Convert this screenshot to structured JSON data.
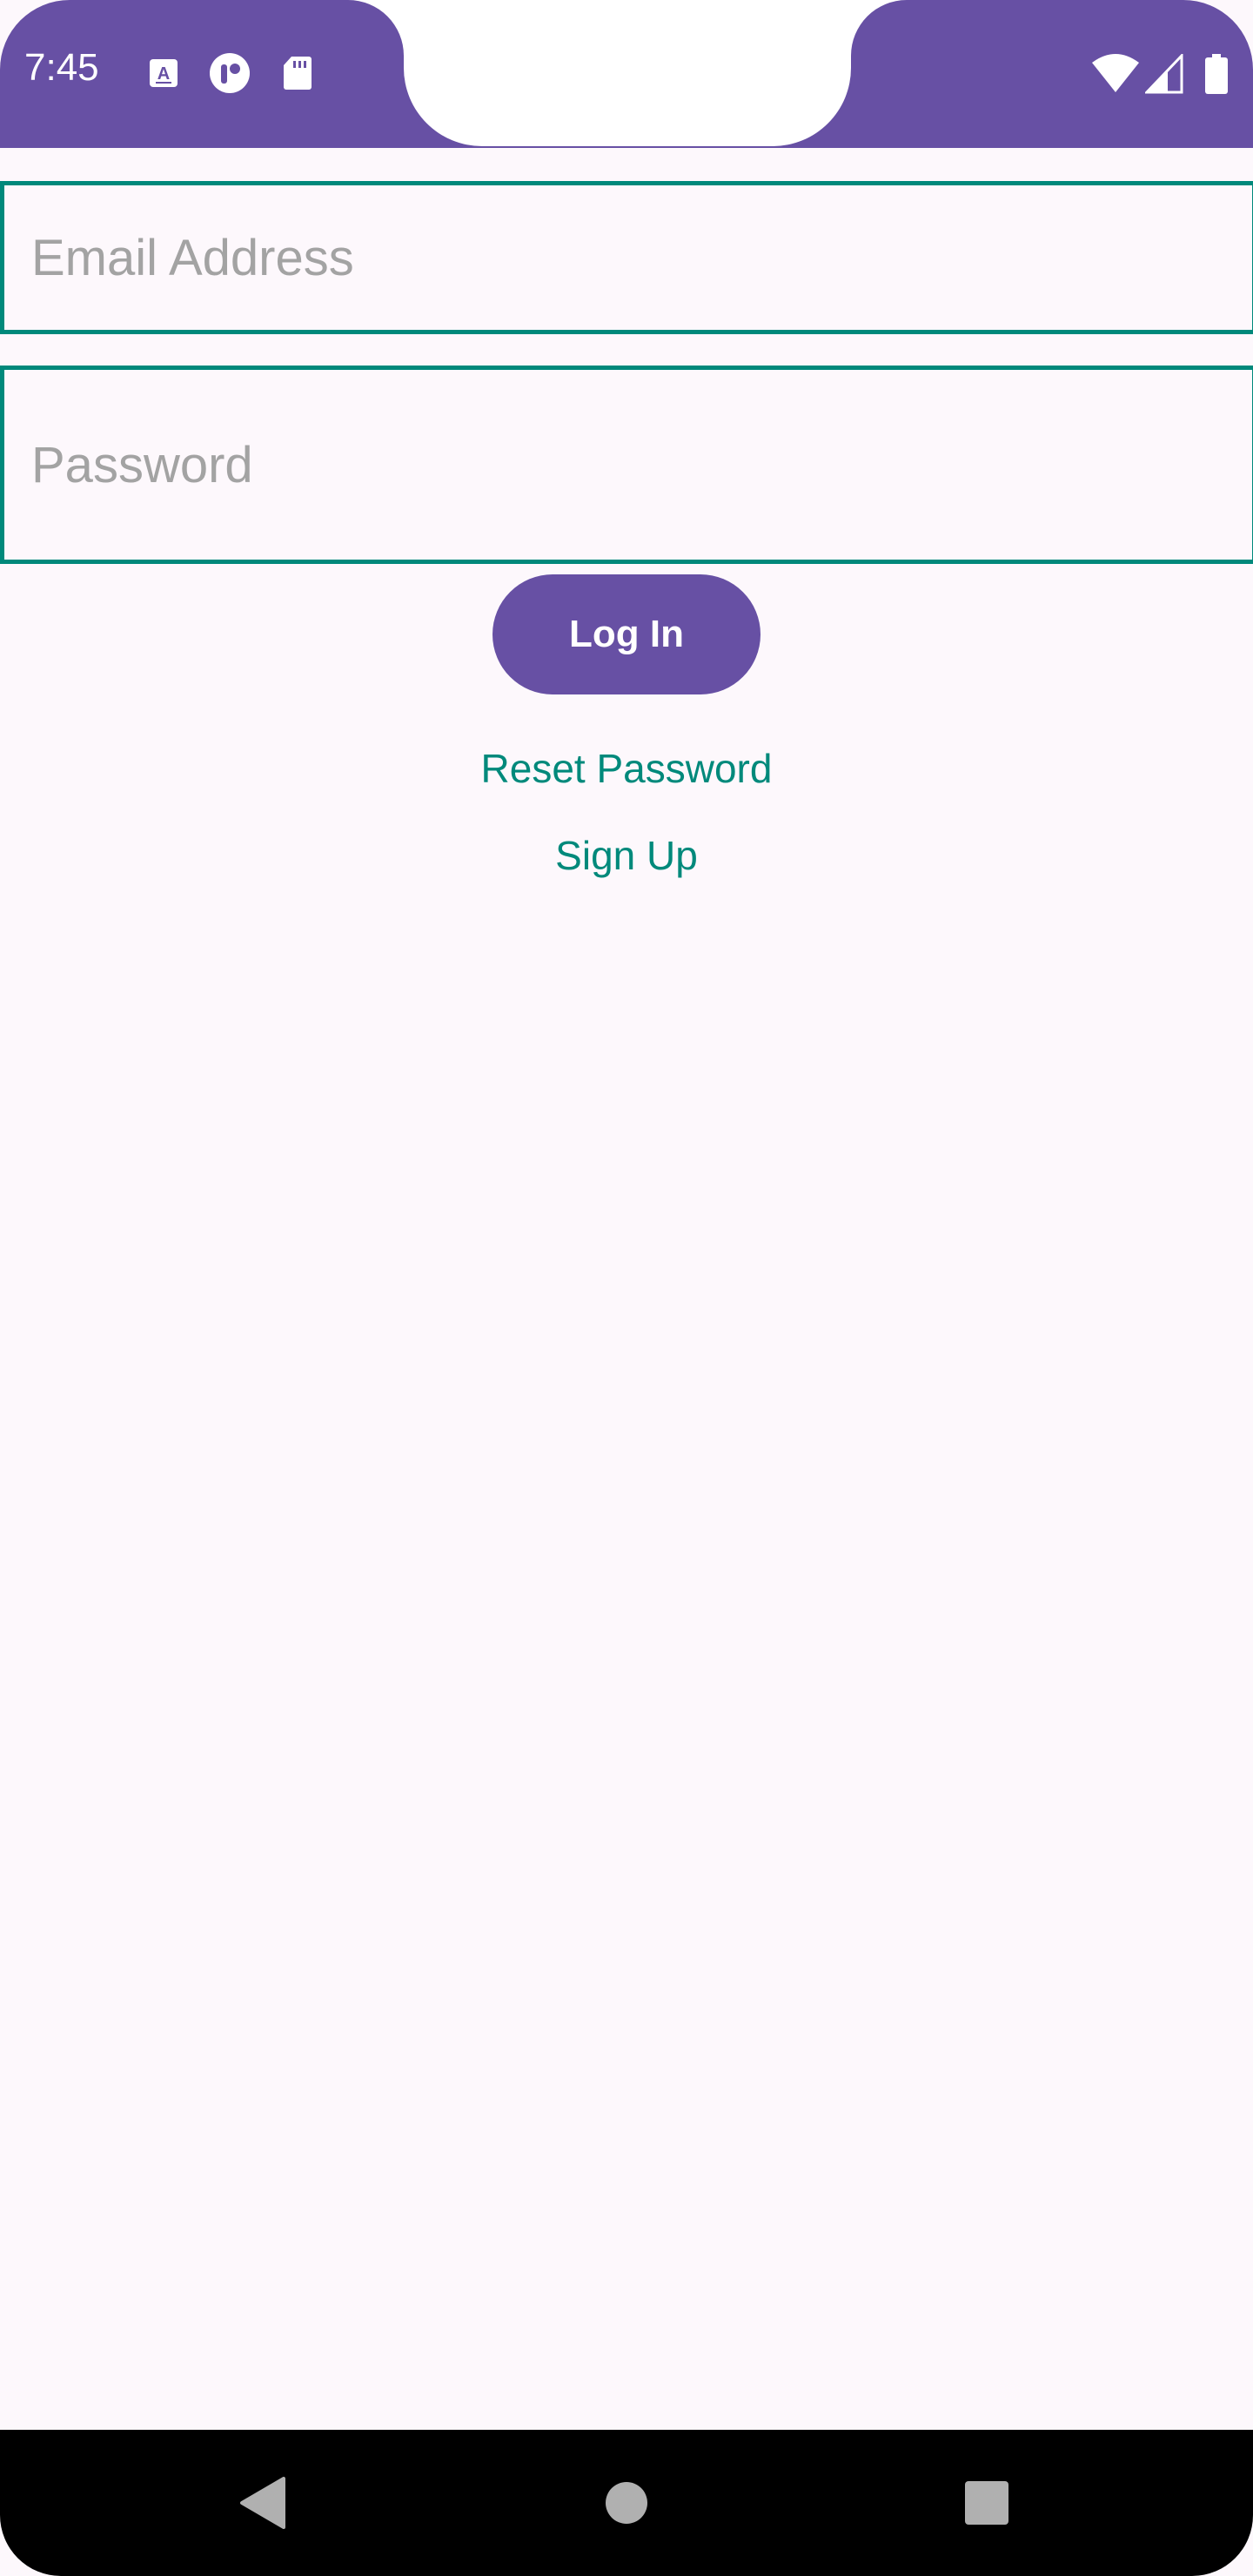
{
  "status_bar": {
    "time": "7:45",
    "left_icons": [
      "text-recognition-icon",
      "app-notification-icon",
      "sd-card-icon"
    ],
    "right_icons": [
      "wifi-icon",
      "cellular-signal-icon",
      "battery-icon"
    ]
  },
  "form": {
    "email_placeholder": "Email Address",
    "email_value": "",
    "password_placeholder": "Password",
    "password_value": "",
    "login_label": "Log In",
    "reset_password_label": "Reset Password",
    "sign_up_label": "Sign Up"
  },
  "nav_bar": {
    "buttons": [
      "back-icon",
      "home-icon",
      "recents-icon"
    ]
  },
  "colors": {
    "primary": "#6750a4",
    "accent": "#00897b",
    "background": "#fdf8fc",
    "placeholder": "#a3a3a3"
  }
}
